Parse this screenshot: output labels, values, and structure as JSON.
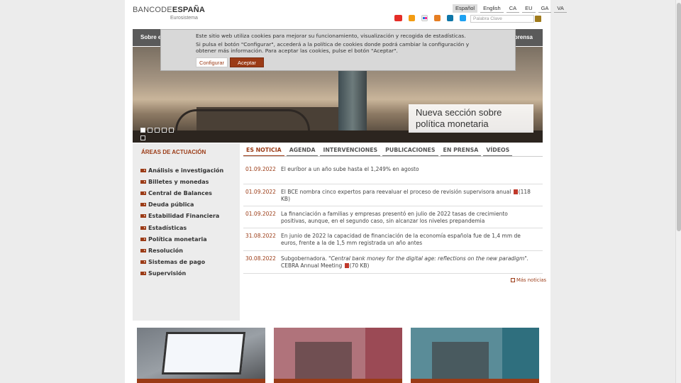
{
  "header": {
    "logo_main_prefix": "BANCODE",
    "logo_main_bold": "ESPAÑA",
    "logo_sub": "Eurosistema",
    "languages": [
      "Español",
      "English",
      "CA",
      "EU",
      "GA",
      "VA"
    ],
    "active_language": "Español",
    "search_placeholder": "Palabra Clave",
    "social_icons": [
      "youtube-icon",
      "rss-icon",
      "flickr-icon",
      "podcast-icon",
      "linkedin-icon",
      "twitter-icon"
    ]
  },
  "nav": {
    "left_partial": "Sobre e",
    "right_partial": "prensa"
  },
  "cookie": {
    "line1": "Este sitio web utiliza cookies para mejorar su funcionamiento, visualización y recogida de estadísticas.",
    "line2": "Si pulsa el botón \"Configurar\", accederá a la política de cookies donde podrá cambiar la configuración y obtener más información. Para aceptar las cookies, pulse el botón \"Aceptar\".",
    "configure_label": "Configurar",
    "accept_label": "Aceptar"
  },
  "hero": {
    "caption": "Nueva sección sobre política monetaria",
    "slide_count": 5,
    "active_slide": 1
  },
  "sidebar": {
    "title": "ÁREAS DE ACTUACIÓN",
    "items": [
      "Análisis e investigación",
      "Billetes y monedas",
      "Central de Balances",
      "Deuda pública",
      "Estabilidad Financiera",
      "Estadísticas",
      "Política monetaria",
      "Resolución",
      "Sistemas de pago",
      "Supervisión"
    ]
  },
  "tabs": [
    "ES NOTICIA",
    "AGENDA",
    "INTERVENCIONES",
    "PUBLICACIONES",
    "EN PRENSA",
    "VÍDEOS"
  ],
  "news": [
    {
      "date": "01.09.2022",
      "text": "El euríbor a un año sube hasta el 1,249% en agosto"
    },
    {
      "date": "01.09.2022",
      "text": "El BCE nombra cinco expertos para reevaluar el proceso de revisión supervisora anual",
      "pdf": "(118 KB)"
    },
    {
      "date": "01.09.2022",
      "text": "La financiación a familias y empresas presentó en julio de 2022 tasas de crecimiento positivas, aunque, en el segundo caso, sin alcanzar los niveles prepandemia"
    },
    {
      "date": "31.08.2022",
      "text": "En junio de 2022 la capacidad de financiación de la economía española fue de 1,4 mm de euros, frente a la de 1,5 mm registrada un año antes"
    },
    {
      "date": "30.08.2022",
      "text_prefix": "Subgobernadora. ",
      "text_italic": "\"Central bank money for the digital age: reflections on the new paradigm\".",
      "text_suffix": " CEBRA Annual Meeting",
      "pdf": "(70 KB)"
    }
  ],
  "more_news": "Más noticias"
}
